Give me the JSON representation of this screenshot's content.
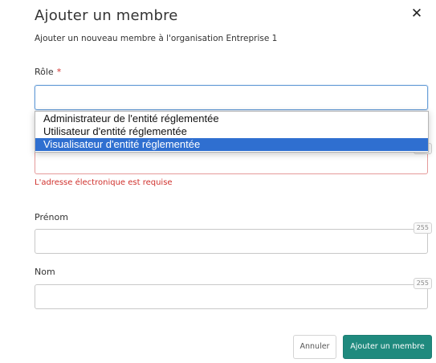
{
  "modal": {
    "title": "Ajouter un membre",
    "subtitle": "Ajouter un nouveau membre à l'organisation Entreprise 1",
    "close_icon": "close-icon"
  },
  "form": {
    "role": {
      "label": "Rôle",
      "required_mark": "*",
      "value": "",
      "options": [
        "Administrateur de l'entité réglementée",
        "Utilisateur d'entité réglementée",
        "Visualisateur d'entité réglementée"
      ],
      "highlighted_option": "Visualisateur d'entité réglementée"
    },
    "email": {
      "value": "",
      "error": "L'adresse électronique est requise",
      "counter": "255"
    },
    "first_name": {
      "label": "Prénom",
      "value": "",
      "counter": "255"
    },
    "last_name": {
      "label": "Nom",
      "value": "",
      "counter": "255"
    }
  },
  "actions": {
    "cancel_label": "Annuler",
    "submit_label": "Ajouter un membre"
  },
  "colors": {
    "primary": "#1f8a7e",
    "error": "#d0312d",
    "selection": "#2f6fd0"
  }
}
